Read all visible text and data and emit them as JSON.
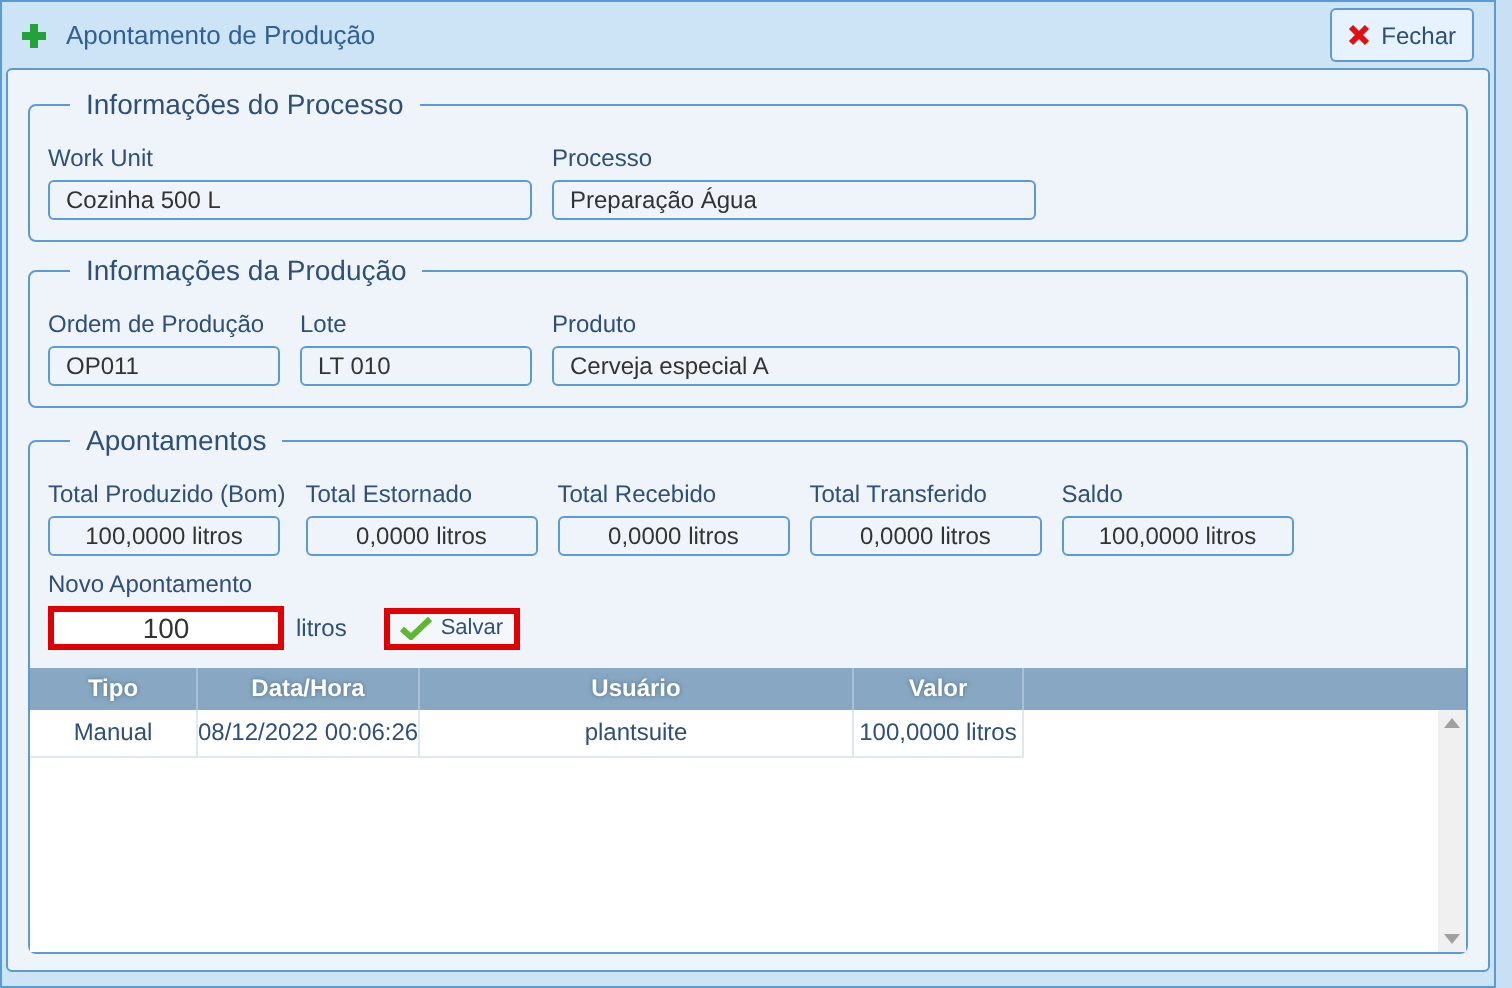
{
  "window": {
    "title": "Apontamento de Produção",
    "close_button": "Fechar"
  },
  "processo": {
    "legend": "Informações do Processo",
    "fields": [
      {
        "label": "Work Unit",
        "value": "Cozinha 500 L"
      },
      {
        "label": "Processo",
        "value": "Preparação Água"
      }
    ]
  },
  "producao": {
    "legend": "Informações da Produção",
    "fields": [
      {
        "label": "Ordem de Produção",
        "value": "OP011"
      },
      {
        "label": "Lote",
        "value": "LT 010"
      },
      {
        "label": "Produto",
        "value": "Cerveja especial A"
      }
    ]
  },
  "apontamentos": {
    "legend": "Apontamentos",
    "totals": [
      {
        "label": "Total Produzido (Bom)",
        "value": "100,0000 litros"
      },
      {
        "label": "Total Estornado",
        "value": "0,0000 litros"
      },
      {
        "label": "Total Recebido",
        "value": "0,0000 litros"
      },
      {
        "label": "Total Transferido",
        "value": "0,0000 litros"
      },
      {
        "label": "Saldo",
        "value": "100,0000 litros"
      }
    ],
    "novo": {
      "label": "Novo Apontamento",
      "value": "100",
      "unit": "litros",
      "highlighted": true
    },
    "save_button": {
      "label": "Salvar",
      "highlighted": true
    },
    "table": {
      "columns": [
        "Tipo",
        "Data/Hora",
        "Usuário",
        "Valor"
      ],
      "rows": [
        [
          "Manual",
          "08/12/2022 00:06:26",
          "plantsuite",
          "100,0000 litros"
        ]
      ]
    }
  }
}
